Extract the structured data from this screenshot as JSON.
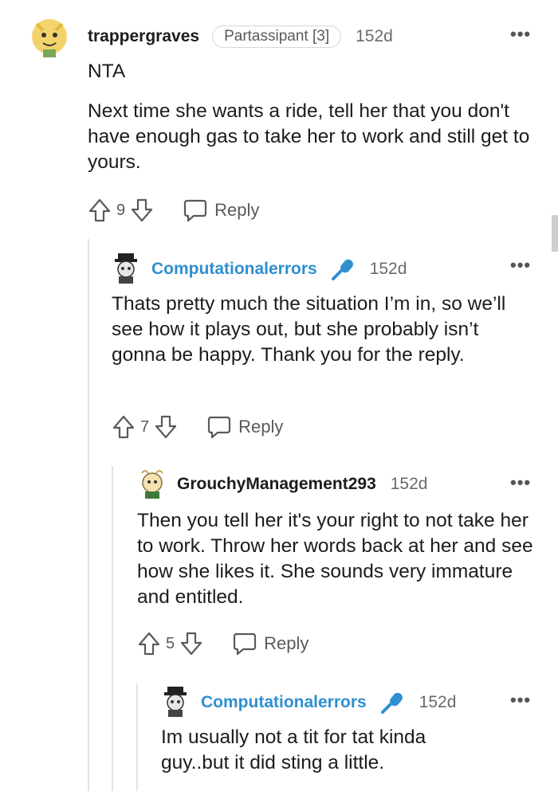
{
  "comments": [
    {
      "username": "trappergraves",
      "flair": "Partassipant [3]",
      "age": "152d",
      "paragraphs": [
        "NTA",
        "Next time she wants a ride, tell her that you don't have enough gas to take her to work and still get to yours."
      ],
      "votes": "9",
      "reply_label": "Reply"
    },
    {
      "username": "Computationalerrors",
      "age": "152d",
      "paragraphs": [
        "Thats pretty much the situation I’m in, so we’ll see how it plays out, but she probably isn’t gonna be happy. Thank you for the reply."
      ],
      "votes": "7",
      "reply_label": "Reply"
    },
    {
      "username": "GrouchyManagement293",
      "age": "152d",
      "paragraphs": [
        "Then you tell her it's your right to not take her to work. Throw her words back at her and see how she likes it. She sounds very immature and entitled."
      ],
      "votes": "5",
      "reply_label": "Reply"
    },
    {
      "username": "Computationalerrors",
      "age": "152d",
      "paragraphs": [
        "Im usually not a tit for tat kinda guy..but it did sting a little."
      ]
    }
  ],
  "colors": {
    "op_username": "#2f8fd0",
    "text": "#1c1c1c",
    "muted": "#6a6a6a",
    "thread_line": "#e3e3e3"
  },
  "icons": {
    "upvote": "arrow-up-outline",
    "downvote": "arrow-down-outline",
    "reply": "speech-bubble",
    "more": "horizontal-ellipsis",
    "op_badge": "microphone"
  }
}
